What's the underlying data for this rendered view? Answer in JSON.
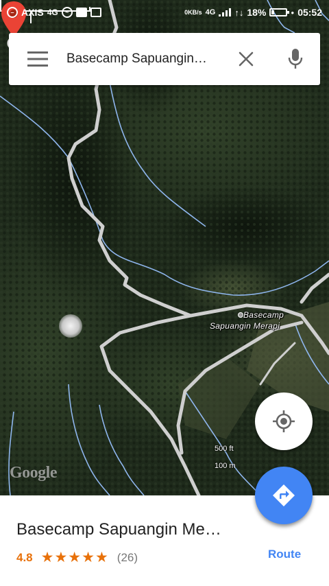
{
  "status_bar": {
    "carrier": "AXIS",
    "carrier_network": "4G",
    "data_rate": "0KB/s",
    "network": "4G",
    "battery": "18%",
    "battery_level": 0.18,
    "time": "05:52"
  },
  "search": {
    "query": "Basecamp Sapuangin Merapi"
  },
  "map": {
    "place_label_line1": "Basecamp",
    "place_label_line2": "Sapuangin Merapi",
    "scale_ft": "500 ft",
    "scale_m": "100 m",
    "logo": "Google",
    "colors": {
      "road": "#cfcfcf",
      "stream": "#8fb6ee",
      "pin": "#ea4335"
    }
  },
  "place": {
    "title": "Basecamp Sapuangin Merapi",
    "rating": "4.8",
    "stars": "★★★★★",
    "star_count": 5,
    "reviews": "(26)",
    "route_label": "Route"
  },
  "icons": {
    "menu": "menu-icon",
    "clear": "close-icon",
    "mic": "mic-icon",
    "locate": "my-location-icon",
    "route": "directions-icon",
    "pin": "map-pin-icon"
  },
  "colors": {
    "accent": "#4285f4",
    "rating": "#e8710a"
  }
}
